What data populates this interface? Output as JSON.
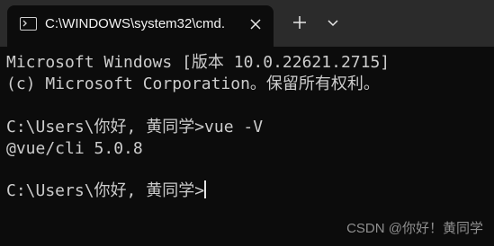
{
  "tab": {
    "title": "C:\\WINDOWS\\system32\\cmd.",
    "icon": "terminal-icon"
  },
  "toolbar": {
    "new_tab_icon": "plus-icon",
    "dropdown_icon": "chevron-down-icon"
  },
  "terminal": {
    "lines": [
      "Microsoft Windows [版本 10.0.22621.2715]",
      "(c) Microsoft Corporation。保留所有权利。",
      "",
      "C:\\Users\\你好, 黄同学>vue -V",
      "@vue/cli 5.0.8",
      "",
      "C:\\Users\\你好, 黄同学>"
    ]
  },
  "watermark": "CSDN @你好！黄同学",
  "colors": {
    "background": "#0c0c0c",
    "titlebar": "#2b2b2b",
    "text": "#cccccc"
  }
}
